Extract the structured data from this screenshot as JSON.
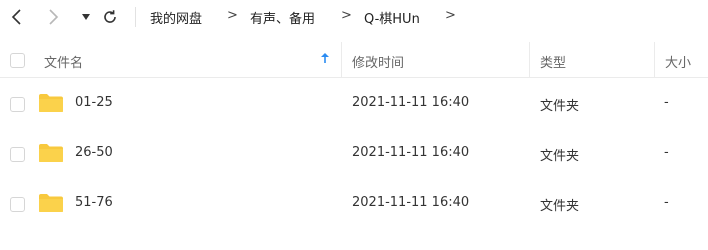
{
  "toolbar": {
    "back_icon": "chevron-left-icon",
    "forward_icon": "chevron-right-icon",
    "dropdown_icon": "caret-down-icon",
    "refresh_icon": "refresh-icon"
  },
  "breadcrumb": {
    "items": [
      "我的网盘",
      "有声、备用",
      "Q-棋HUn"
    ],
    "separator": ">"
  },
  "table": {
    "headers": {
      "name": "文件名",
      "modified": "修改时间",
      "type": "类型",
      "size": "大小"
    },
    "sort_icon": "arrow-up-icon",
    "accent_color": "#2b8cf2",
    "folder_color": "#f8c93e",
    "rows": [
      {
        "name": "01-25",
        "modified": "2021-11-11 16:40",
        "type": "文件夹",
        "size": "-"
      },
      {
        "name": "26-50",
        "modified": "2021-11-11 16:40",
        "type": "文件夹",
        "size": "-"
      },
      {
        "name": "51-76",
        "modified": "2021-11-11 16:40",
        "type": "文件夹",
        "size": "-"
      }
    ]
  }
}
